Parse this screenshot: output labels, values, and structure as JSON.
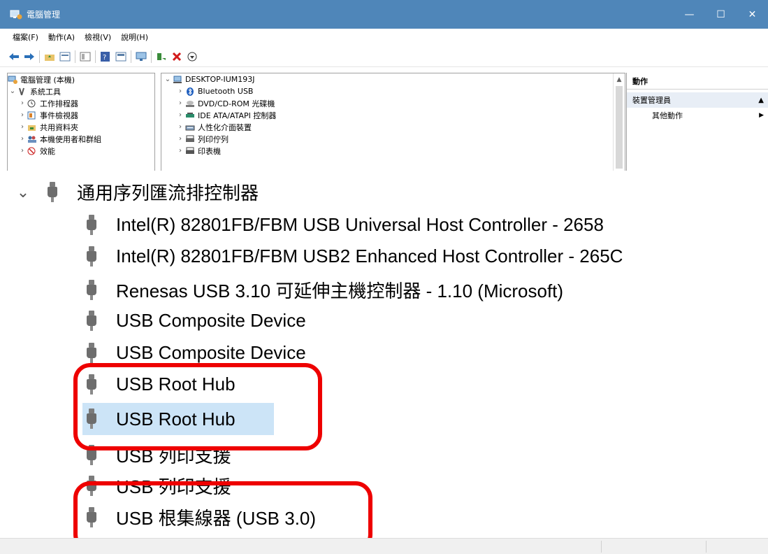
{
  "window": {
    "title": "電腦管理",
    "buttons": [
      "—",
      "☐",
      "✕"
    ]
  },
  "menu": [
    "檔案(F)",
    "動作(A)",
    "檢視(V)",
    "說明(H)"
  ],
  "toolbar_icons": [
    "back-icon",
    "forward-icon",
    "folder-up-icon",
    "properties-icon",
    "show-hide-console-tree-icon",
    "help-icon",
    "view-icon",
    "monitor-icon",
    "enable-device-icon",
    "uninstall-icon",
    "download-icon"
  ],
  "left_tree": [
    {
      "label": "電腦管理 (本機)",
      "icon": "computer-manage-icon",
      "chev": ""
    },
    {
      "label": "系統工具",
      "icon": "tools-icon",
      "chev": "v"
    },
    {
      "label": "工作排程器",
      "icon": "clock-icon",
      "chev": ">"
    },
    {
      "label": "事件檢視器",
      "icon": "event-viewer-icon",
      "chev": ">"
    },
    {
      "label": "共用資料夾",
      "icon": "shared-folder-icon",
      "chev": ">"
    },
    {
      "label": "本機使用者和群組",
      "icon": "users-icon",
      "chev": ">"
    },
    {
      "label": "效能",
      "icon": "performance-icon",
      "chev": ">"
    }
  ],
  "device_tree": {
    "root": "DESKTOP-IUM193J",
    "items": [
      "Bluetooth USB",
      "DVD/CD-ROM 光碟機",
      "IDE ATA/ATAPI 控制器",
      "人性化介面裝置",
      "列印佇列",
      "印表機"
    ]
  },
  "actions_pane": {
    "header": "動作",
    "section": "裝置管理員",
    "item": "其他動作"
  },
  "zoomed": {
    "category": "通用序列匯流排控制器",
    "devices": [
      "Intel(R) 82801FB/FBM USB Universal Host Controller - 2658",
      "Intel(R) 82801FB/FBM USB2 Enhanced Host Controller - 265C",
      "Renesas USB 3.10 可延伸主機控制器 - 1.10 (Microsoft)",
      "USB Composite Device",
      "USB Composite Device",
      "USB Root Hub",
      "USB Root Hub",
      "USB 列印支援",
      "USB 列印支援",
      "USB 根集線器 (USB 3.0)"
    ],
    "selected_index": 6
  },
  "colors": {
    "titlebar": "#4f86b9",
    "selection": "#cce4f7",
    "annotation": "#ee0000"
  }
}
